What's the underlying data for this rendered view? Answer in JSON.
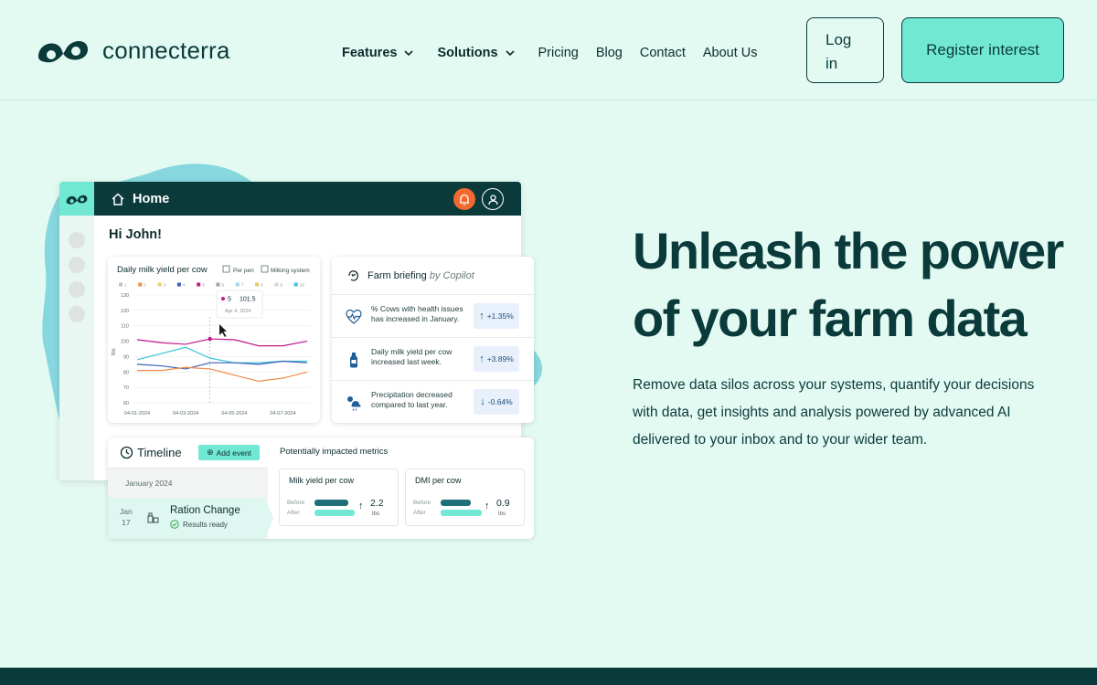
{
  "brand": {
    "name": "connecterra"
  },
  "nav": {
    "items": [
      {
        "label": "Features",
        "dropdown": true
      },
      {
        "label": "Solutions",
        "dropdown": true
      },
      {
        "label": "Pricing",
        "dropdown": false
      },
      {
        "label": "Blog",
        "dropdown": false
      },
      {
        "label": "Contact",
        "dropdown": false
      },
      {
        "label": "About Us",
        "dropdown": false
      }
    ],
    "login_label": "Log in",
    "register_label": "Register interest"
  },
  "hero": {
    "title": "Unleash the power of your farm data",
    "description": "Remove data silos across your systems, quantify your decisions with data, get insights and analysis powered by advanced AI delivered to your inbox and to your wider team."
  },
  "app": {
    "header_title": "Home",
    "greeting": "Hi John!",
    "chart": {
      "title": "Daily milk yield per cow",
      "toggle_per_pen": "Per pen",
      "toggle_milking": "Milking system",
      "pens": [
        "1",
        "2",
        "3",
        "4",
        "5",
        "6",
        "7",
        "8",
        "9",
        "10"
      ],
      "tooltip_pen": "5",
      "tooltip_value": "101.5",
      "tooltip_date": "Apr 4, 2024"
    },
    "briefing": {
      "title": "Farm briefing",
      "by": "by Copilot",
      "items": [
        {
          "icon": "heart-pulse-icon",
          "text": "% Cows with health issues has increased in January.",
          "change": "+1.35%",
          "direction": "up"
        },
        {
          "icon": "milk-bottle-icon",
          "text": "Daily milk yield per cow increased last week.",
          "change": "+3.89%",
          "direction": "up"
        },
        {
          "icon": "weather-icon",
          "text": "Precipitation decreased compared to last year.",
          "change": "-0.64%",
          "direction": "down"
        }
      ]
    },
    "timeline": {
      "title": "Timeline",
      "add_event": "Add event",
      "month": "January 2024",
      "event": {
        "date_month": "Jan",
        "date_day": "17",
        "name": "Ration Change",
        "status": "Results ready"
      }
    },
    "metrics": {
      "title": "Potentially impacted metrics",
      "before_label": "Before",
      "after_label": "After",
      "cards": [
        {
          "title": "Milk yield per cow",
          "value": "2.2",
          "unit": "lbs"
        },
        {
          "title": "DMI per cow",
          "value": "0.9",
          "unit": "lbs"
        }
      ]
    }
  },
  "colors": {
    "background": "#e3faf2",
    "primary": "#0b3a3b",
    "accent": "#70e8d3",
    "alert": "#f26a2e"
  },
  "chart_data": {
    "type": "line",
    "title": "Daily milk yield per cow",
    "ylabel": "lbs",
    "x": [
      "04-01-2024",
      "04-02-2024",
      "04-03-2024",
      "04-04-2024",
      "04-05-2024",
      "04-06-2024",
      "04-07-2024",
      "04-08-2024"
    ],
    "xtick_labels": [
      "04-01-2024",
      "04-03-2024",
      "04-05-2024",
      "04-07-2024"
    ],
    "yticks": [
      60,
      70,
      80,
      90,
      100,
      110,
      120,
      130
    ],
    "ylim": [
      60,
      130
    ],
    "grid": true,
    "series": [
      {
        "name": "5",
        "color": "#c2188a",
        "values": [
          101,
          99,
          98,
          101.5,
          101,
          97,
          97,
          100
        ]
      },
      {
        "color": "#3ac3d8",
        "values": [
          88,
          92,
          96,
          89,
          86,
          86,
          87,
          87
        ]
      },
      {
        "color": "#3b5fb8",
        "values": [
          85,
          84,
          82,
          86,
          86,
          85,
          87,
          86
        ]
      },
      {
        "color": "#f08a4b",
        "values": [
          81,
          81,
          83,
          82,
          78,
          74,
          76,
          80
        ]
      }
    ]
  }
}
